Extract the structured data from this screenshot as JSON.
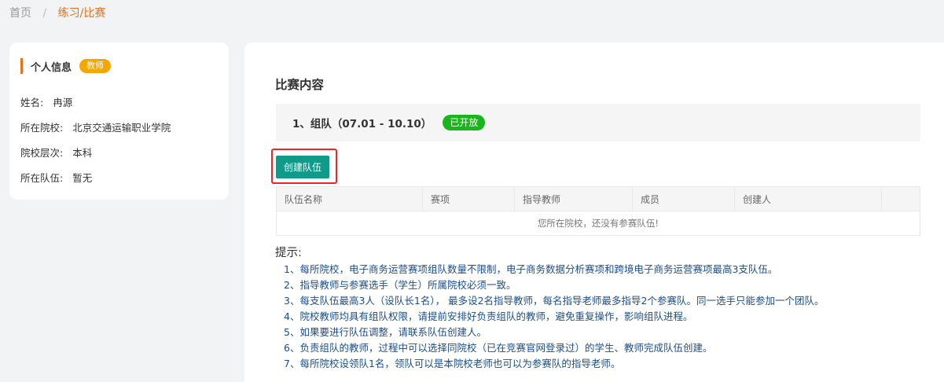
{
  "breadcrumb": {
    "home": "首页",
    "separator": "/",
    "current": "练习/比赛"
  },
  "profile": {
    "title": "个人信息",
    "role": "教师",
    "fields": [
      {
        "label": "姓名:",
        "value": "冉源"
      },
      {
        "label": "所在院校:",
        "value": "北京交通运输职业学院"
      },
      {
        "label": "院校层次:",
        "value": "本科"
      },
      {
        "label": "所在队伍:",
        "value": "暂无"
      }
    ]
  },
  "main": {
    "section_title": "比赛内容",
    "stage": {
      "label": "1、组队（07.01 - 10.10）",
      "status": "已开放"
    },
    "create_button": "创建队伍",
    "table": {
      "columns": [
        "队伍名称",
        "赛项",
        "指导教师",
        "成员",
        "创建人",
        ""
      ],
      "empty_message": "您所在院校，还没有参赛队伍!"
    },
    "tips": {
      "title": "提示:",
      "items": [
        "1、每所院校，电子商务运营赛项组队数量不限制，电子商务数据分析赛项和跨境电子商务运营赛项最高3支队伍。",
        "2、指导教师与参赛选手（学生）所属院校必须一致。",
        "3、每支队伍最高3人（设队长1名），  最多设2名指导教师，每名指导老师最多指导2个参赛队。同一选手只能参加一个团队。",
        "4、院校教师均具有组队权限，请提前安排好负责组队的教师，避免重复操作，影响组队进程。",
        "5、如果要进行队伍调整，请联系队伍创建人。",
        "6、负责组队的教师，过程中可以选择同院校（已在竞赛官网登录过）的学生、教师完成队伍创建。",
        "7、每所院校设领队1名，领队可以是本院校老师也可以为参赛队的指导老师。"
      ]
    }
  },
  "colors": {
    "accent_orange": "#e8711a",
    "badge_yellow": "#f5a700",
    "open_green": "#1ab51a",
    "button_teal": "#0f9a8a",
    "highlight_red": "#e8262b",
    "tip_blue": "#1a4d8c"
  }
}
